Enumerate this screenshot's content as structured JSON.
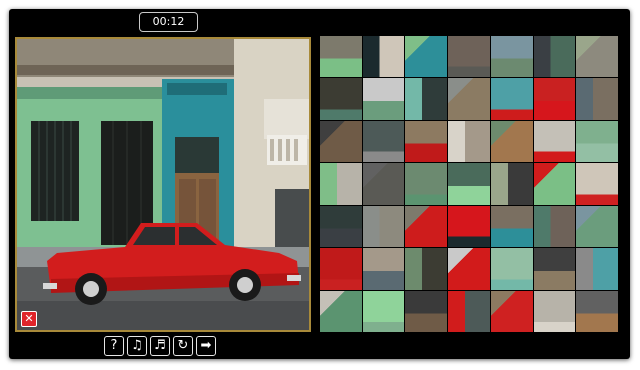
{
  "game": {
    "timer": "00:12",
    "preview_close_label": "✕",
    "toolbar": [
      {
        "name": "help-button",
        "icon": "help-icon",
        "label": "?"
      },
      {
        "name": "music-toggle-button",
        "icon": "music-note-icon",
        "label": "♫"
      },
      {
        "name": "sound-toggle-button",
        "icon": "sound-note-icon",
        "label": "♬"
      },
      {
        "name": "restart-button",
        "icon": "restart-icon",
        "label": "↻"
      },
      {
        "name": "next-button",
        "icon": "arrow-right-icon",
        "label": "➡"
      }
    ],
    "board": {
      "rows": 7,
      "cols": 7,
      "tile_palette": [
        [
          "#7d7a6c",
          "#1b2a2e",
          "#2d8f99",
          "#6e6259",
          "#7a95a0",
          "#3a3f44",
          "#8d8a7e"
        ],
        [
          "#3c3c33",
          "#c9c9c9",
          "#73b8a8",
          "#8b7b63",
          "#4ea0a6",
          "#c92121",
          "#5a6a72"
        ],
        [
          "#6f5b47",
          "#4d5a58",
          "#8d7a61",
          "#d8d3c9",
          "#a2774e",
          "#c4c0b7",
          "#7fb08e"
        ],
        [
          "#7fbe88",
          "#5a5a55",
          "#6c8a70",
          "#4a6b5b",
          "#9aa68b",
          "#7bbf86",
          "#cfc6b9"
        ],
        [
          "#2f3c3a",
          "#8a8e8a",
          "#ce1c1c",
          "#d6161c",
          "#7a6f61",
          "#4f7a6a",
          "#6b9d7d"
        ],
        [
          "#c01a1a",
          "#a4998a",
          "#6d8b6d",
          "#d21b1b",
          "#93bfa4",
          "#3f3f3f",
          "#8a8a8a"
        ],
        [
          "#5b9470",
          "#8fd39a",
          "#3a3a3a",
          "#d11c1c",
          "#cf2121",
          "#b7b3a9",
          "#616161"
        ]
      ]
    }
  }
}
